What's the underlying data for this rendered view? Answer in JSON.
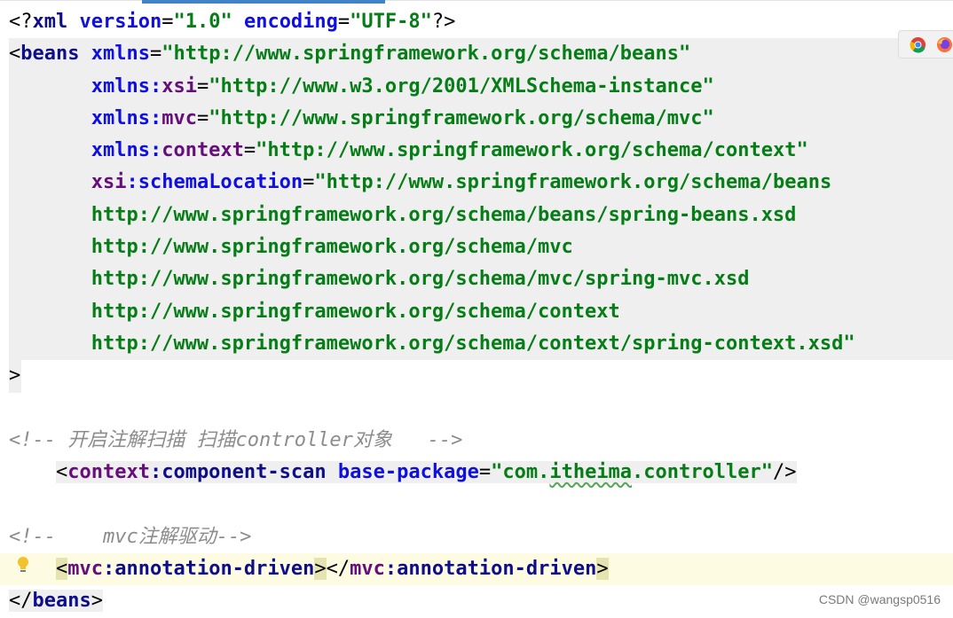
{
  "editor": {
    "active_tab_color": "#4083c9",
    "lines": {
      "l1": {
        "open": "<?",
        "name": "xml",
        "a1": "version",
        "v1": "\"1.0\"",
        "a2": "encoding",
        "v2": "\"UTF-8\"",
        "close": "?>"
      },
      "l2": {
        "open": "<",
        "tag": "beans",
        "attr": "xmlns",
        "val": "\"http://www.springframework.org/schema/beans\""
      },
      "l3": {
        "prefix": "xmlns",
        "colon": ":",
        "local": "xsi",
        "val": "\"http://www.w3.org/2001/XMLSchema-instance\""
      },
      "l4": {
        "prefix": "xmlns",
        "colon": ":",
        "local": "mvc",
        "val": "\"http://www.springframework.org/schema/mvc\""
      },
      "l5": {
        "prefix": "xmlns",
        "colon": ":",
        "local": "context",
        "val": "\"http://www.springframework.org/schema/context\""
      },
      "l6": {
        "prefix": "xsi",
        "colon": ":",
        "local": "schemaLocation",
        "val": "\"http://www.springframework.org/schema/beans"
      },
      "l7": {
        "val": "http://www.springframework.org/schema/beans/spring-beans.xsd"
      },
      "l8": {
        "val": "http://www.springframework.org/schema/mvc"
      },
      "l9": {
        "val": "http://www.springframework.org/schema/mvc/spring-mvc.xsd"
      },
      "l10": {
        "val": "http://www.springframework.org/schema/context"
      },
      "l11": {
        "val": "http://www.springframework.org/schema/context/spring-context.xsd\""
      },
      "l12": {
        "close": ">"
      },
      "l14": {
        "comment": "<!-- 开启注解扫描 扫描controller对象   -->"
      },
      "l15": {
        "open": "<",
        "ns": "context",
        "colon": ":",
        "tag": "component-scan",
        "attr": "base-package",
        "val_q1": "\"com.",
        "val_sq": "itheima",
        "val_q2": ".controller\"",
        "close": "/>"
      },
      "l17": {
        "comment": "<!--    mvc注解驱动-->"
      },
      "l18": {
        "open": "<",
        "ns": "mvc",
        "colon": ":",
        "tag": "annotation-driven",
        "gt": ">",
        "open2": "</",
        "ns2": "mvc",
        "colon2": ":",
        "tag2": "annotation-driven",
        "close": ">"
      },
      "l19": {
        "open": "</",
        "tag": "beans",
        "close": ">"
      }
    }
  },
  "popup": {
    "icons": [
      "chrome-icon",
      "firefox-icon"
    ]
  },
  "watermark": "CSDN @wangsp0516"
}
